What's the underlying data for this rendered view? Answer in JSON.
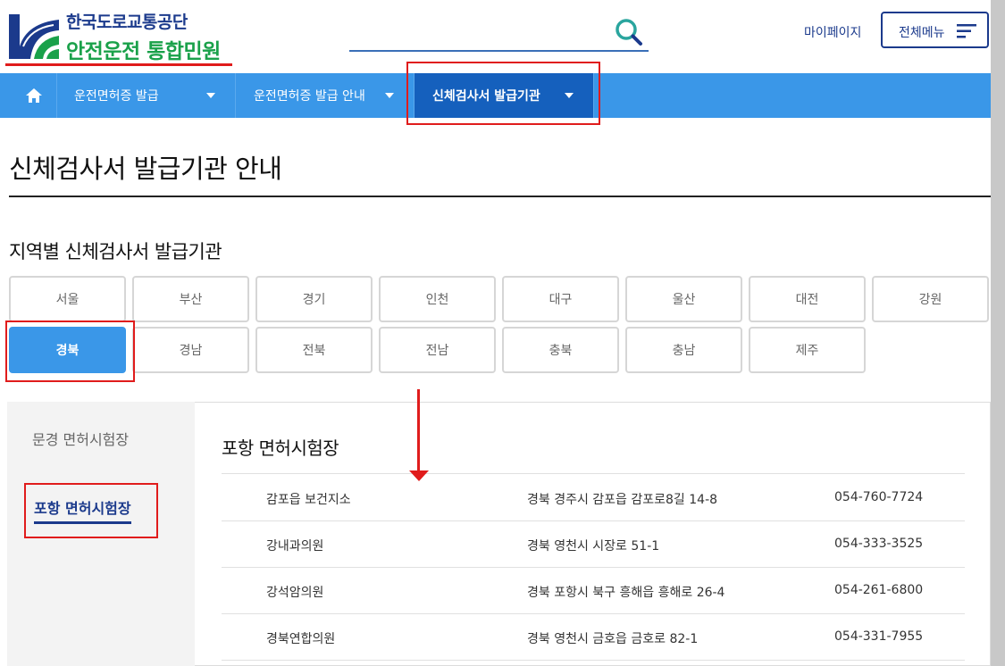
{
  "header": {
    "org_name": "한국도로교통공단",
    "service_name": "안전운전 통합민원",
    "search_placeholder": "",
    "mypage_label": "마이페이지",
    "allmenu_label": "전체메뉴"
  },
  "nav": {
    "home_icon": "home-icon",
    "items": [
      {
        "label": "운전면허증 발급",
        "active": false
      },
      {
        "label": "운전면허증 발급 안내",
        "active": false
      },
      {
        "label": "신체검사서 발급기관",
        "active": true
      }
    ]
  },
  "page_title": "신체검사서 발급기관 안내",
  "section_title": "지역별 신체검사서 발급기관",
  "regions": [
    [
      "서울",
      "부산",
      "경기",
      "인천",
      "대구",
      "울산",
      "대전",
      "강원"
    ],
    [
      "경북",
      "경남",
      "전북",
      "전남",
      "충북",
      "충남",
      "제주"
    ]
  ],
  "selected_region": "경북",
  "side_menu": {
    "items": [
      "문경 면허시험장",
      "포항 면허시험장"
    ],
    "selected": "포항 면허시험장"
  },
  "content": {
    "title": "포항 면허시험장",
    "rows": [
      {
        "name": "감포읍 보건지소",
        "address": "경북 경주시 감포읍 감포로8길 14-8",
        "phone": "054-760-7724"
      },
      {
        "name": "강내과의원",
        "address": "경북 영천시 시장로 51-1",
        "phone": "054-333-3525"
      },
      {
        "name": "강석암의원",
        "address": "경북 포항시 북구 흥해읍 흥해로 26-4",
        "phone": "054-261-6800"
      },
      {
        "name": "경북연합의원",
        "address": "경북 영천시 금호읍 금호로 82-1",
        "phone": "054-331-7955"
      }
    ]
  },
  "colors": {
    "primary_blue": "#3a97e8",
    "active_nav": "#1560bd",
    "brand_navy": "#1b3a8c",
    "brand_green": "#1aa14a",
    "annotation_red": "#e01c1c"
  }
}
